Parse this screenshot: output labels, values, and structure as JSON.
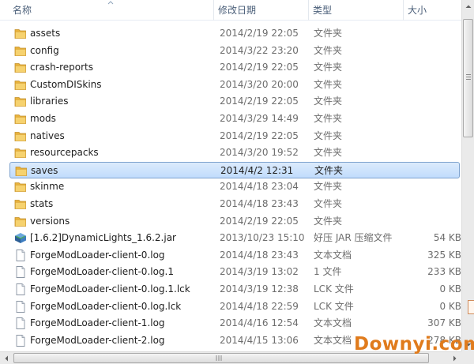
{
  "header": {
    "name": "名称",
    "date": "修改日期",
    "type": "类型",
    "size": "大小"
  },
  "files": [
    {
      "name": "assets",
      "date": "2014/2/19 22:05",
      "type": "文件夹",
      "size": "",
      "icon": "folder-icon",
      "selected": false
    },
    {
      "name": "config",
      "date": "2014/3/22 23:20",
      "type": "文件夹",
      "size": "",
      "icon": "folder-icon",
      "selected": false
    },
    {
      "name": "crash-reports",
      "date": "2014/2/19 22:05",
      "type": "文件夹",
      "size": "",
      "icon": "folder-icon",
      "selected": false
    },
    {
      "name": "CustomDISkins",
      "date": "2014/3/20 20:00",
      "type": "文件夹",
      "size": "",
      "icon": "folder-icon",
      "selected": false
    },
    {
      "name": "libraries",
      "date": "2014/2/19 22:05",
      "type": "文件夹",
      "size": "",
      "icon": "folder-icon",
      "selected": false
    },
    {
      "name": "mods",
      "date": "2014/3/29 14:49",
      "type": "文件夹",
      "size": "",
      "icon": "folder-icon",
      "selected": false
    },
    {
      "name": "natives",
      "date": "2014/2/19 22:05",
      "type": "文件夹",
      "size": "",
      "icon": "folder-icon",
      "selected": false
    },
    {
      "name": "resourcepacks",
      "date": "2014/3/20 19:52",
      "type": "文件夹",
      "size": "",
      "icon": "folder-icon",
      "selected": false
    },
    {
      "name": "saves",
      "date": "2014/4/2 12:31",
      "type": "文件夹",
      "size": "",
      "icon": "folder-icon",
      "selected": true
    },
    {
      "name": "skinme",
      "date": "2014/4/18 23:04",
      "type": "文件夹",
      "size": "",
      "icon": "folder-icon",
      "selected": false
    },
    {
      "name": "stats",
      "date": "2014/4/18 23:43",
      "type": "文件夹",
      "size": "",
      "icon": "folder-icon",
      "selected": false
    },
    {
      "name": "versions",
      "date": "2014/2/19 22:05",
      "type": "文件夹",
      "size": "",
      "icon": "folder-icon",
      "selected": false
    },
    {
      "name": "[1.6.2]DynamicLights_1.6.2.jar",
      "date": "2013/10/23 15:10",
      "type": "好压 JAR 压缩文件",
      "size": "54 KB",
      "icon": "jar-archive-icon",
      "selected": false
    },
    {
      "name": "ForgeModLoader-client-0.log",
      "date": "2014/4/18 23:43",
      "type": "文本文档",
      "size": "325 KB",
      "icon": "document-icon",
      "selected": false
    },
    {
      "name": "ForgeModLoader-client-0.log.1",
      "date": "2014/3/19 13:02",
      "type": "1 文件",
      "size": "233 KB",
      "icon": "document-icon",
      "selected": false
    },
    {
      "name": "ForgeModLoader-client-0.log.1.lck",
      "date": "2014/3/19 12:38",
      "type": "LCK 文件",
      "size": "0 KB",
      "icon": "document-icon",
      "selected": false
    },
    {
      "name": "ForgeModLoader-client-0.log.lck",
      "date": "2014/4/18 22:59",
      "type": "LCK 文件",
      "size": "0 KB",
      "icon": "document-icon",
      "selected": false
    },
    {
      "name": "ForgeModLoader-client-1.log",
      "date": "2014/4/16 12:54",
      "type": "文本文档",
      "size": "307 KB",
      "icon": "document-icon",
      "selected": false
    },
    {
      "name": "ForgeModLoader-client-2.log",
      "date": "2014/4/15 13:06",
      "type": "文本文档",
      "size": "278 KB",
      "icon": "document-icon",
      "selected": false
    }
  ],
  "watermark": "Downyi.com",
  "colors": {
    "header_text": "#4c607a",
    "selection_fill": "#cce2fc",
    "selection_border": "#7da2ce",
    "folder": "#f1c453",
    "watermark": "#e07b1c"
  }
}
